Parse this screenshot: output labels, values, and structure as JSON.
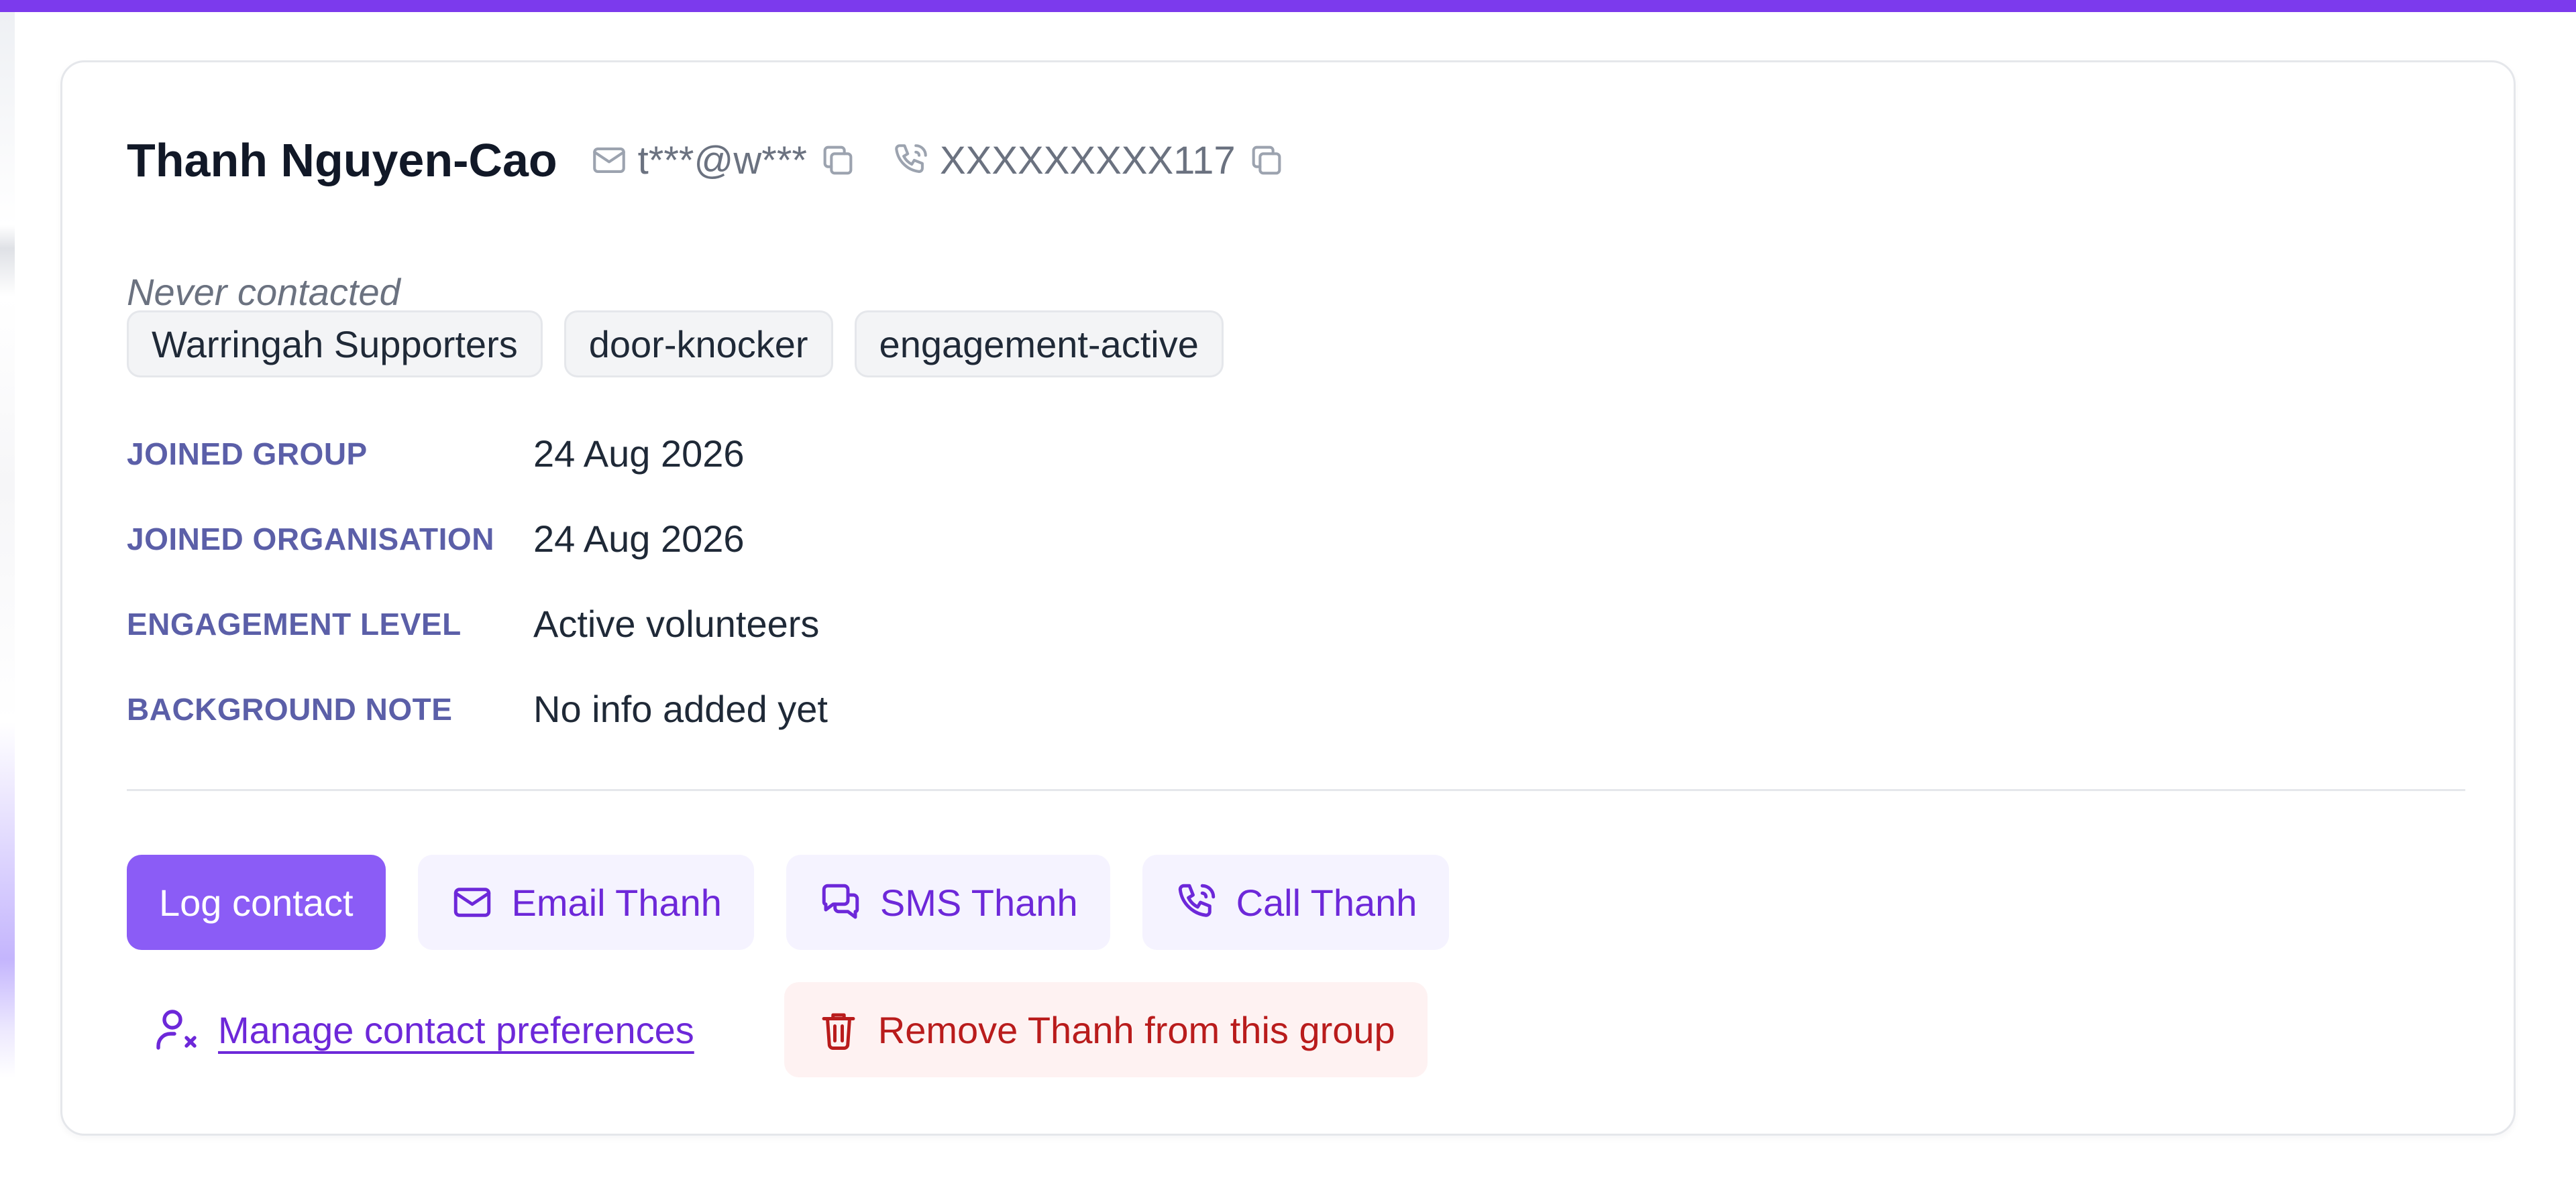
{
  "contact": {
    "name": "Thanh Nguyen-Cao",
    "email_masked": "t***@w***",
    "phone_masked": "XXXXXXXXX117",
    "status": "Never contacted"
  },
  "tags": [
    "Warringah Supporters",
    "door-knocker",
    "engagement-active"
  ],
  "fields": [
    {
      "label": "JOINED GROUP",
      "value": "24 Aug 2026"
    },
    {
      "label": "JOINED ORGANISATION",
      "value": "24 Aug 2026"
    },
    {
      "label": "ENGAGEMENT LEVEL",
      "value": "Active volunteers"
    },
    {
      "label": "BACKGROUND NOTE",
      "value": "No info added yet"
    }
  ],
  "actions": {
    "log_contact": "Log contact",
    "email": "Email Thanh",
    "sms": "SMS Thanh",
    "call": "Call Thanh",
    "manage_preferences": "Manage contact preferences",
    "remove": "Remove Thanh from this group"
  },
  "colors": {
    "accent": "#7c3aed",
    "primary_button": "#8b5cf6",
    "soft_button_bg": "#f5f3ff",
    "danger_bg": "#fef2f2",
    "danger_text": "#b91c1c",
    "label_color": "#5b5fa8"
  },
  "icons": {
    "email": "mail-icon",
    "phone": "phone-icon",
    "copy": "copy-icon",
    "sms": "chat-icon",
    "preferences": "user-x-icon",
    "remove": "trash-icon"
  }
}
